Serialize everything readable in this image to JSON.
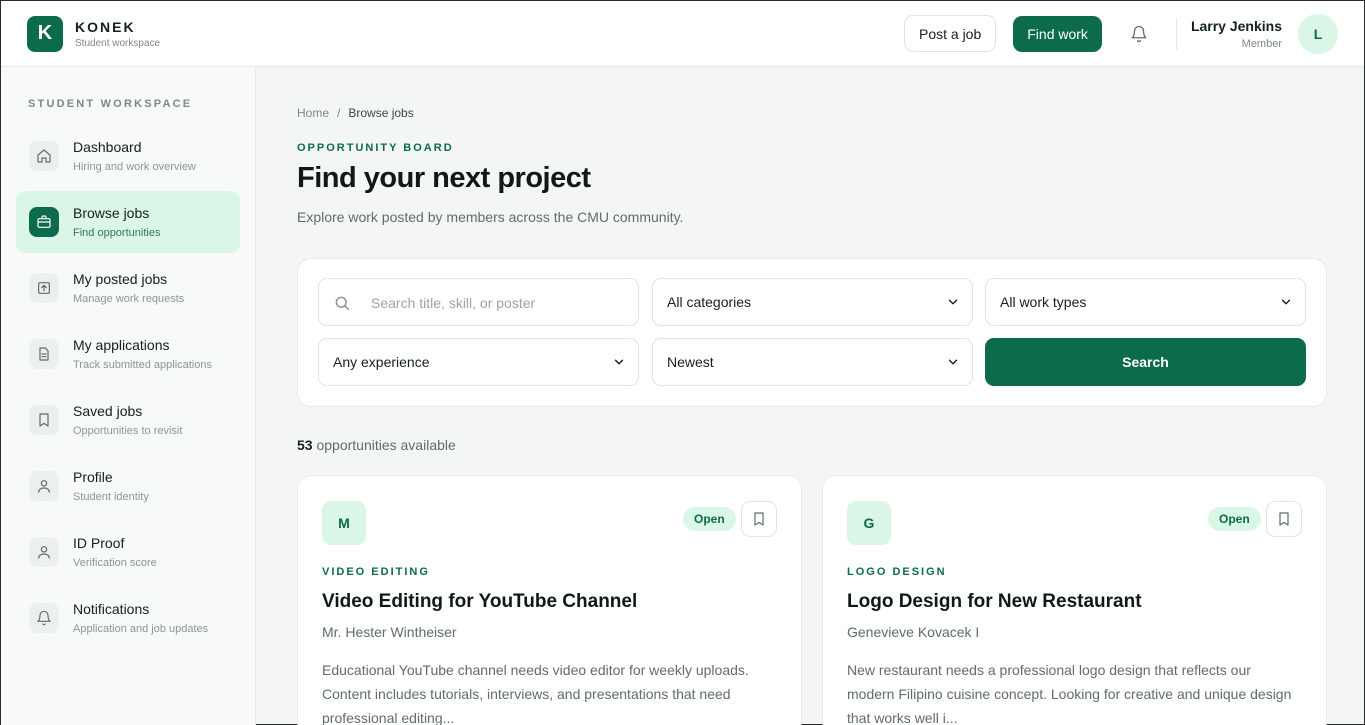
{
  "brand": {
    "logo_letter": "K",
    "name": "KONEK",
    "subtitle": "Student workspace"
  },
  "header": {
    "post_job_label": "Post a job",
    "find_work_label": "Find work",
    "user_name": "Larry Jenkins",
    "user_role": "Member",
    "avatar_letter": "L"
  },
  "sidebar": {
    "heading": "STUDENT WORKSPACE",
    "items": [
      {
        "label": "Dashboard",
        "desc": "Hiring and work overview",
        "icon": "home-icon"
      },
      {
        "label": "Browse jobs",
        "desc": "Find opportunities",
        "icon": "briefcase-icon",
        "active": true
      },
      {
        "label": "My posted jobs",
        "desc": "Manage work requests",
        "icon": "upload-icon"
      },
      {
        "label": "My applications",
        "desc": "Track submitted applications",
        "icon": "document-icon"
      },
      {
        "label": "Saved jobs",
        "desc": "Opportunities to revisit",
        "icon": "bookmark-icon"
      },
      {
        "label": "Profile",
        "desc": "Student identity",
        "icon": "user-icon"
      },
      {
        "label": "ID Proof",
        "desc": "Verification score",
        "icon": "user-icon"
      },
      {
        "label": "Notifications",
        "desc": "Application and job updates",
        "icon": "bell-icon"
      }
    ]
  },
  "breadcrumb": {
    "home": "Home",
    "separator": "/",
    "current": "Browse jobs"
  },
  "page": {
    "eyebrow": "OPPORTUNITY BOARD",
    "title": "Find your next project",
    "subtitle": "Explore work posted by members across the CMU community."
  },
  "filters": {
    "search_placeholder": "Search title, skill, or poster",
    "category": "All categories",
    "work_type": "All work types",
    "experience": "Any experience",
    "sort": "Newest",
    "search_button": "Search"
  },
  "results": {
    "count": "53",
    "suffix": "opportunities available"
  },
  "jobs": [
    {
      "avatar": "M",
      "status": "Open",
      "category": "VIDEO EDITING",
      "title": "Video Editing for YouTube Channel",
      "poster": "Mr. Hester Wintheiser",
      "description": "Educational YouTube channel needs video editor for weekly uploads. Content includes tutorials, interviews, and presentations that need professional editing..."
    },
    {
      "avatar": "G",
      "status": "Open",
      "category": "LOGO DESIGN",
      "title": "Logo Design for New Restaurant",
      "poster": "Genevieve Kovacek I",
      "description": "New restaurant needs a professional logo design that reflects our modern Filipino cuisine concept. Looking for creative and unique design that works well i..."
    }
  ],
  "colors": {
    "brand": "#0c6b4c",
    "brand_light": "#d9f6e6"
  }
}
